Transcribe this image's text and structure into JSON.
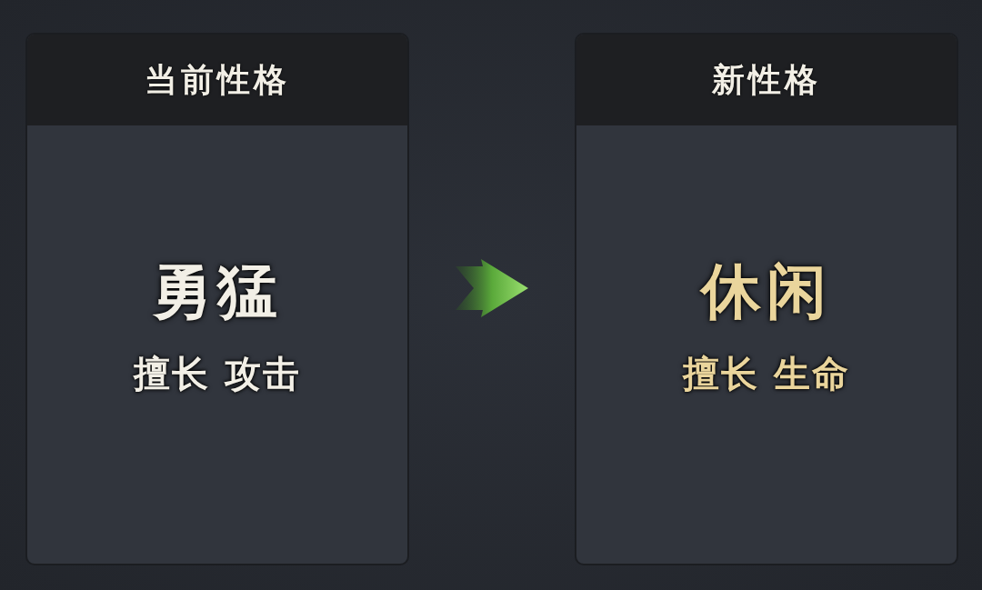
{
  "cards": [
    {
      "title": "当前性格",
      "name": "勇猛",
      "specialty": "擅长 攻击",
      "color": "#f2efe6"
    },
    {
      "title": "新性格",
      "name": "休闲",
      "specialty": "擅长 生命",
      "color": "#ead59c"
    }
  ]
}
